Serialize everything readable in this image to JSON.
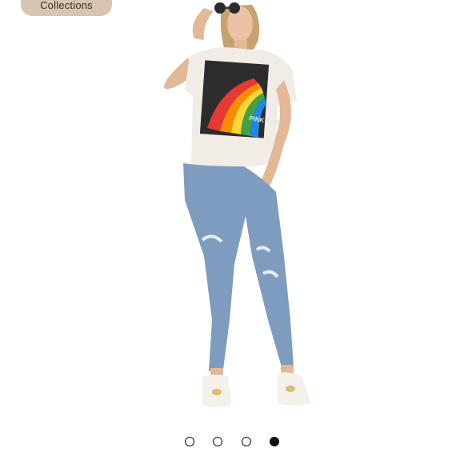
{
  "header": {
    "collections_label": "Collections"
  },
  "product_image": {
    "icon": "model-photo",
    "graphic_text": "PINK FLOYD"
  },
  "carousel": {
    "slide_count": 4,
    "active_index": 4
  },
  "colors": {
    "pill_bg": "#d8c5b1",
    "dot": "#111111"
  }
}
